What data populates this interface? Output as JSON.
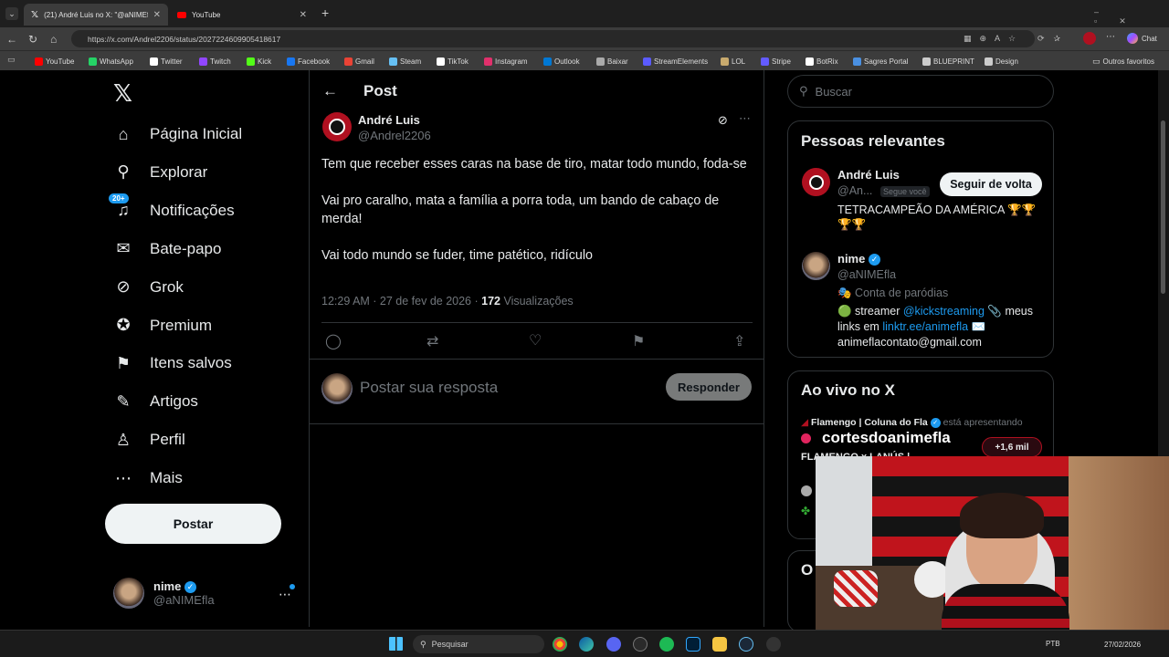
{
  "browser": {
    "tabs": [
      {
        "label": "(21) André Luis no X: \"@aNIMEfla",
        "icon": "x-logo-icon"
      },
      {
        "label": "YouTube",
        "icon": "youtube-icon"
      }
    ],
    "url": "https://x.com/Andrel2206/status/2027224609905418617",
    "right_label": "Chat",
    "bookmarks": [
      {
        "label": "YouTube",
        "color": "#ff0000"
      },
      {
        "label": "WhatsApp",
        "color": "#25d366"
      },
      {
        "label": "Twitter",
        "color": "#ffffff"
      },
      {
        "label": "Twitch",
        "color": "#9146ff"
      },
      {
        "label": "Kick",
        "color": "#53fc18"
      },
      {
        "label": "Facebook",
        "color": "#1877f2"
      },
      {
        "label": "Gmail",
        "color": "#ea4335"
      },
      {
        "label": "Steam",
        "color": "#66c0f4"
      },
      {
        "label": "TikTok",
        "color": "#ffffff"
      },
      {
        "label": "Instagram",
        "color": "#e1306c"
      },
      {
        "label": "Outlook",
        "color": "#0078d4"
      },
      {
        "label": "Baixar",
        "color": "#aaaaaa"
      },
      {
        "label": "StreamElements",
        "color": "#5b5bff"
      },
      {
        "label": "LOL",
        "color": "#c8aa6e"
      },
      {
        "label": "Stripe",
        "color": "#635bff"
      },
      {
        "label": "BotRix",
        "color": "#ffffff"
      },
      {
        "label": "Sagres Portal",
        "color": "#4a90e2"
      },
      {
        "label": "BLUEPRINT",
        "color": "#cccccc"
      },
      {
        "label": "Design",
        "color": "#cccccc"
      }
    ],
    "other_favorites": "Outros favoritos"
  },
  "sidebar": {
    "items": [
      {
        "label": "Página Inicial",
        "icon": "home-icon"
      },
      {
        "label": "Explorar",
        "icon": "search-icon"
      },
      {
        "label": "Notificações",
        "icon": "bell-icon",
        "badge": "20+"
      },
      {
        "label": "Bate-papo",
        "icon": "mail-icon"
      },
      {
        "label": "Grok",
        "icon": "grok-icon"
      },
      {
        "label": "Premium",
        "icon": "verified-icon"
      },
      {
        "label": "Itens salvos",
        "icon": "bookmark-icon"
      },
      {
        "label": "Artigos",
        "icon": "article-icon"
      },
      {
        "label": "Perfil",
        "icon": "person-icon"
      },
      {
        "label": "Mais",
        "icon": "more-circle-icon"
      }
    ],
    "post_button": "Postar",
    "account": {
      "name": "nime",
      "handle": "@aNIMEfla"
    }
  },
  "post": {
    "header": "Post",
    "author_name": "André Luis",
    "author_handle": "@Andrel2206",
    "paragraphs": [
      "Tem que receber esses caras na base de tiro, matar todo mundo, foda-se",
      "Vai pro caralho, mata a família a porra toda, um bando de cabaço de merda!",
      "Vai todo mundo se fuder, time patético, ridículo"
    ],
    "timestamp": "12:29 AM · 27 de fev de 2026 · ",
    "views_count": "172",
    "views_label": "Visualizações",
    "reply_placeholder": "Postar sua resposta",
    "reply_button": "Responder"
  },
  "right": {
    "search_placeholder": "Buscar",
    "relevant_title": "Pessoas relevantes",
    "people": [
      {
        "name": "André Luis",
        "handle": "@An...",
        "follows_you": "Segue você",
        "bio": "TETRACAMPEÃO DA AMÉRICA 🏆🏆🏆🏆",
        "follow_button": "Seguir de volta"
      },
      {
        "name": "nime",
        "handle": "@aNIMEfla",
        "parody": "🎭 Conta de paródias",
        "bio_prefix": "🟢 streamer ",
        "bio_link1": "@kickstreaming",
        "bio_mid": " 📎 meus links em ",
        "bio_link2": "linktr.ee/animefla",
        "bio_suffix": " ✉️ animeflacontato@gmail.com"
      }
    ],
    "live_title": "Ao vivo no X",
    "live_host": "Flamengo | Coluna do Fla",
    "live_presenting": "está apresentando",
    "live_text": "FLAMENGO x LANÚS |",
    "live_count": "+1,6 mil",
    "next_title": "O",
    "overlay_text": "cortesdoanimefla"
  },
  "taskbar": {
    "search_placeholder": "Pesquisar",
    "lang": "PTB",
    "date": "27/02/2026"
  },
  "colors": {
    "accent": "#1d9bf0",
    "flamengo": "#b01020",
    "bg": "#000000"
  }
}
